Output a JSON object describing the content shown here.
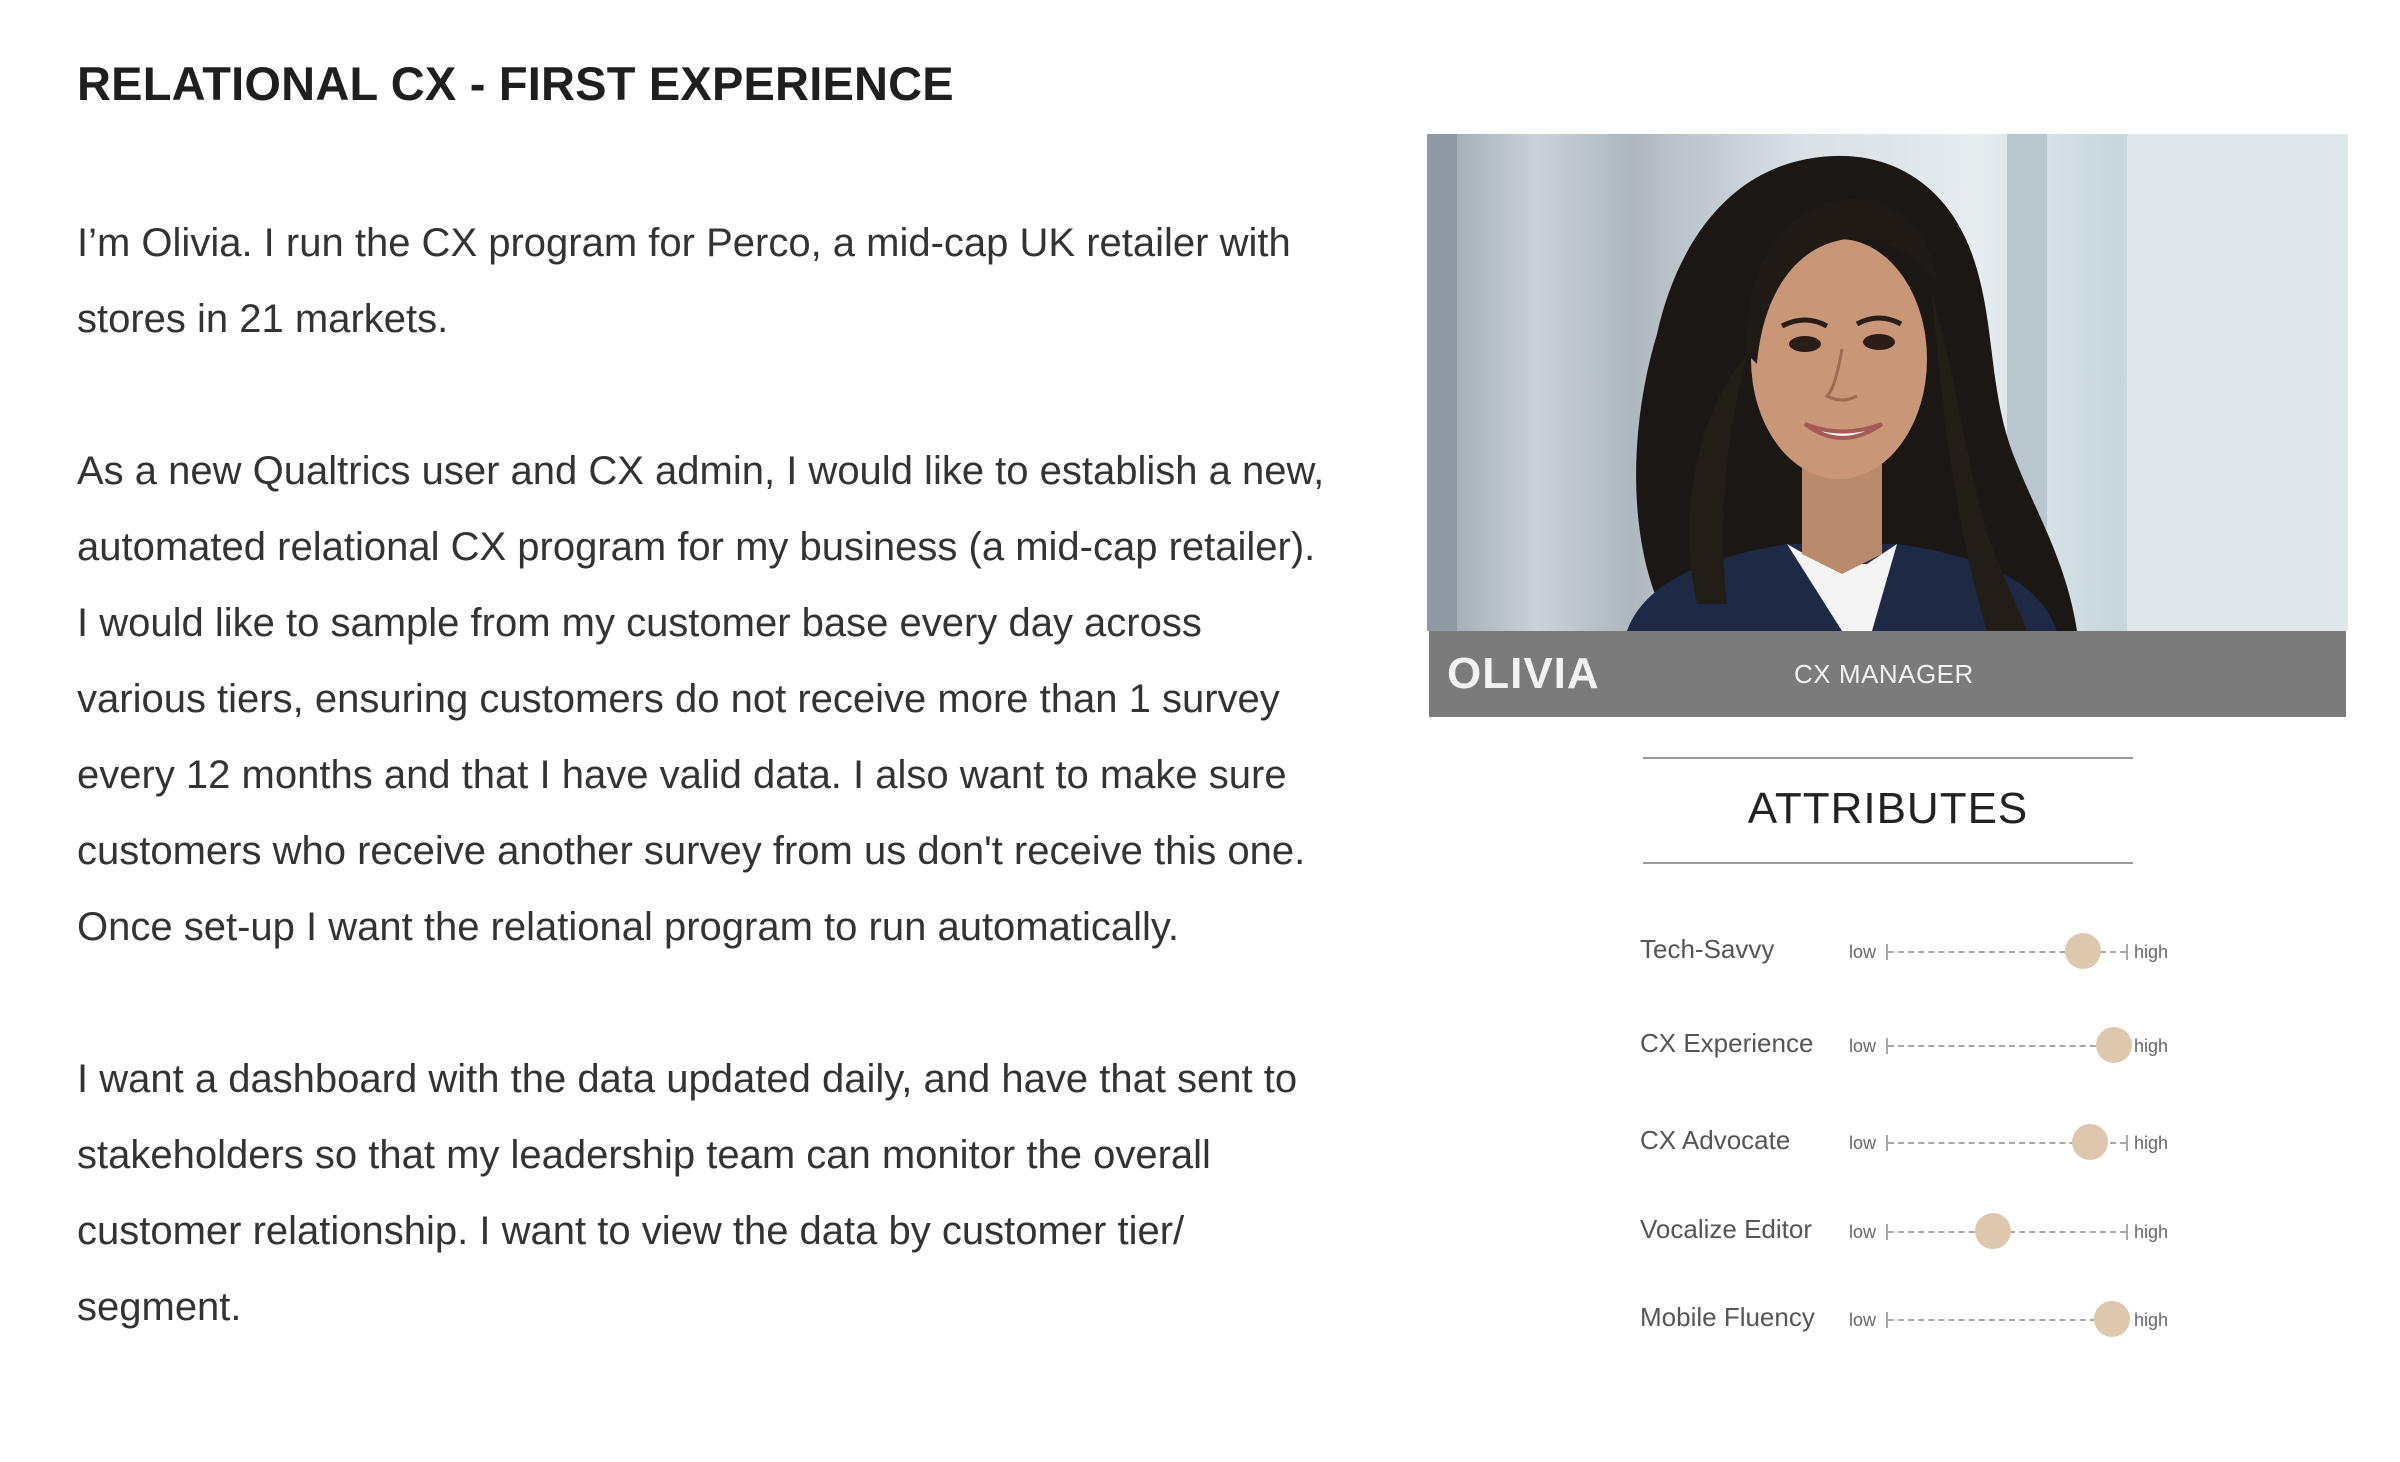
{
  "page": {
    "title": "RELATIONAL CX - FIRST EXPERIENCE"
  },
  "story": {
    "paragraphs": [
      "I’m Olivia. I run the CX program for Perco, a mid-cap UK retailer with stores in 21 markets.",
      "As a new Qualtrics user and CX admin, I would like to establish a new, automated relational CX program for my business (a mid-cap retailer). I would like to sample from my customer base every day across various tiers, ensuring customers do not receive more than 1 survey every 12 months and that I have valid data. I also want to make sure customers who receive another survey from us don't receive this one. Once set-up I want the relational program to run automatically.",
      "I want a dashboard with the data updated daily, and have that sent to stakeholders so that my leadership team can monitor the overall customer relationship. I want to view the data by customer tier/ segment."
    ]
  },
  "persona": {
    "name": "OLIVIA",
    "role": "CX MANAGER"
  },
  "attributes": {
    "heading": "ATTRIBUTES",
    "scale_low": "low",
    "scale_high": "high",
    "knob_color": "#dec8ad",
    "bar_color": "#7b7b7b",
    "items": [
      {
        "label": "Tech-Savvy",
        "level": 0.82
      },
      {
        "label": "CX Experience",
        "level": 0.95
      },
      {
        "label": "CX Advocate",
        "level": 0.85
      },
      {
        "label": "Vocalize Editor",
        "level": 0.44
      },
      {
        "label": "Mobile Fluency",
        "level": 0.94
      }
    ]
  }
}
